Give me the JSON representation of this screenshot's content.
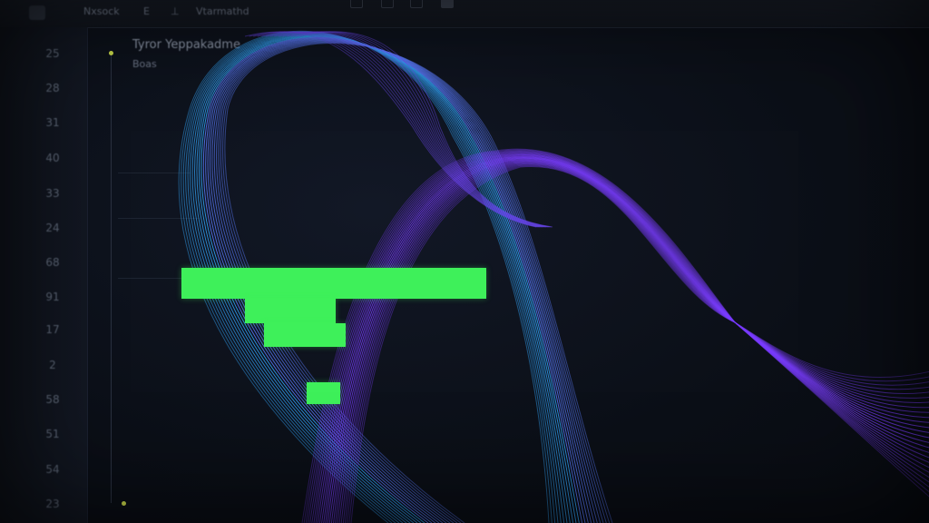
{
  "toolbar": {
    "menu1": "Nxsock",
    "icon1": "E",
    "icon2": "⊥",
    "menu2": "Vtarmathd"
  },
  "panel": {
    "title": "Tyror Yeppakadme",
    "subtitle": "Boas"
  },
  "axis": {
    "ticks": [
      "25",
      "28",
      "31",
      "40",
      "33",
      "24",
      "68",
      "91",
      "17",
      "2",
      "58",
      "51",
      "54",
      "23"
    ]
  },
  "colors": {
    "bar": "#3ef05a",
    "wave_blue": "#34a8ff",
    "wave_purple": "#7a3cff",
    "marker": "#c9d84a"
  },
  "icons": [
    "document-icon",
    "window-icon",
    "pointer-icon",
    "square-icon"
  ]
}
